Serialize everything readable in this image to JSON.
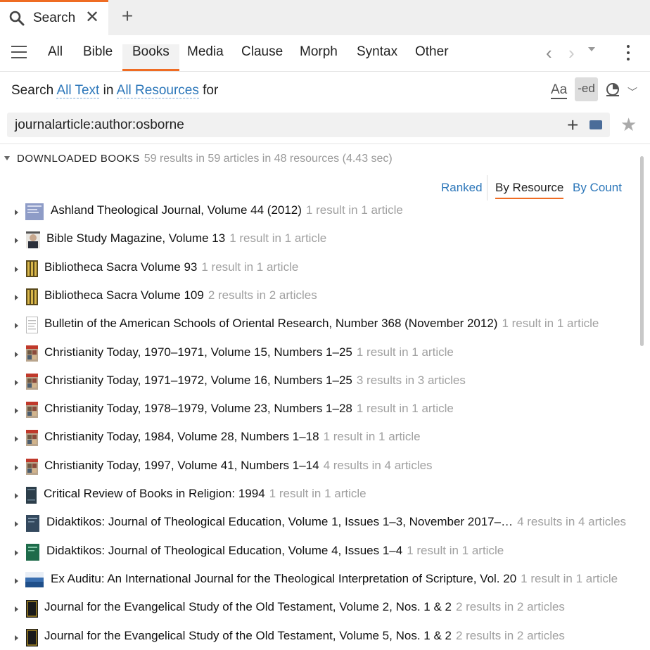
{
  "tab": {
    "label": "Search",
    "close": "✕",
    "new": "+"
  },
  "nav": {
    "tabs": [
      "All",
      "Bible",
      "Books",
      "Media",
      "Clause",
      "Morph",
      "Syntax",
      "Other"
    ],
    "active": "Books",
    "back": "‹",
    "forward": "›"
  },
  "search": {
    "prefix": "Search",
    "scope": "All Text",
    "in": "in",
    "resources": "All Resources",
    "for": "for",
    "query": "journalarticle:author:osborne",
    "opt_case": "Aa",
    "opt_ed": "-ed",
    "add": "+"
  },
  "group": {
    "title": "DOWNLOADED BOOKS",
    "summary": "59 results in 59 articles in 48 resources (4.43 sec)"
  },
  "sort": [
    "Ranked",
    "By Resource",
    "By Count"
  ],
  "accent_color": "#ef6c23",
  "link_color": "#2b76b9",
  "results": [
    {
      "title": "Ashland Theological Journal, Volume 44 (2012)",
      "count": "1 result in 1 article",
      "cover": "ashland"
    },
    {
      "title": "Bible Study Magazine, Volume 13",
      "count": "1 result in 1 article",
      "cover": "portrait"
    },
    {
      "title": "Bibliotheca Sacra Volume 93",
      "count": "1 result in 1 article",
      "cover": "bibsac"
    },
    {
      "title": "Bibliotheca Sacra Volume 109",
      "count": "2 results in 2 articles",
      "cover": "bibsac"
    },
    {
      "title": "Bulletin of the American Schools of Oriental Research, Number 368 (November 2012)",
      "count": "1 result in 1 article",
      "cover": "document"
    },
    {
      "title": "Christianity Today, 1970–1971, Volume 15, Numbers 1–25",
      "count": "1 result in 1 article",
      "cover": "ct"
    },
    {
      "title": "Christianity Today, 1971–1972, Volume 16, Numbers 1–25",
      "count": "3 results in 3 articles",
      "cover": "ct"
    },
    {
      "title": "Christianity Today, 1978–1979, Volume 23, Numbers 1–28",
      "count": "1 result in 1 article",
      "cover": "ct"
    },
    {
      "title": "Christianity Today, 1984, Volume 28, Numbers 1–18",
      "count": "1 result in 1 article",
      "cover": "ct"
    },
    {
      "title": "Christianity Today, 1997, Volume 41, Numbers 1–14",
      "count": "4 results in 4 articles",
      "cover": "ct"
    },
    {
      "title": "Critical Review of Books in Religion: 1994",
      "count": "1 result in 1 article",
      "cover": "crbr"
    },
    {
      "title": "Didaktikos: Journal of Theological Education, Volume 1, Issues 1–3, November 2017–…",
      "count": "4 results in 4 articles",
      "cover": "didak1"
    },
    {
      "title": "Didaktikos: Journal of Theological Education, Volume 4, Issues 1–4",
      "count": "1 result in 1 article",
      "cover": "didak4"
    },
    {
      "title": "Ex Auditu: An International Journal for the Theological Interpretation of Scripture, Vol. 20",
      "count": "1 result in 1 article",
      "cover": "exauditu"
    },
    {
      "title": "Journal for the Evangelical Study of the Old Testament, Volume 2, Nos. 1 & 2",
      "count": "2 results in 2 articles",
      "cover": "jesot"
    },
    {
      "title": "Journal for the Evangelical Study of the Old Testament, Volume 5, Nos. 1 & 2",
      "count": "2 results in 2 articles",
      "cover": "jesot"
    }
  ]
}
